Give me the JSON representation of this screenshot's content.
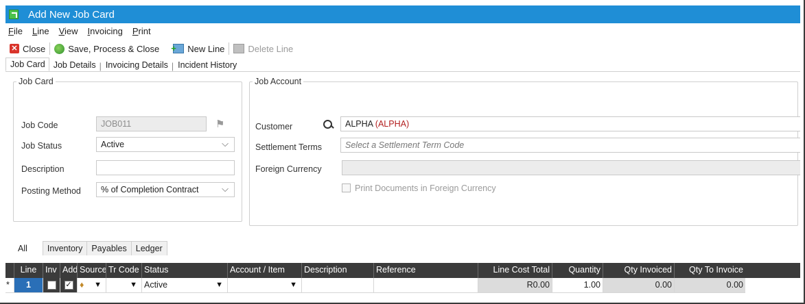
{
  "window": {
    "title": "Add New Job Card"
  },
  "menu": [
    "File",
    "Line",
    "View",
    "Invoicing",
    "Print"
  ],
  "menu_underlines": [
    "F",
    "L",
    "V",
    "I",
    "P"
  ],
  "toolbar": {
    "close": "Close",
    "save_process_close": "Save, Process & Close",
    "new_line": "New Line",
    "delete_line": "Delete Line"
  },
  "tabs": [
    "Job Card",
    "Job Details",
    "Invoicing Details",
    "Incident History"
  ],
  "job_card": {
    "legend": "Job Card",
    "job_code_label": "Job Code",
    "job_code_value": "JOB011",
    "job_status_label": "Job Status",
    "job_status_value": "Active",
    "description_label": "Description",
    "description_value": "",
    "posting_method_label": "Posting Method",
    "posting_method_value": "% of Completion Contract"
  },
  "job_account": {
    "legend": "Job Account",
    "customer_label": "Customer",
    "customer_code": "ALPHA",
    "customer_paren": "(ALPHA)",
    "settlement_terms_label": "Settlement Terms",
    "settlement_terms_placeholder": "Select a Settlement Term Code",
    "foreign_currency_label": "Foreign Currency",
    "foreign_currency_value": "",
    "print_foreign_label": "Print Documents in Foreign Currency"
  },
  "line_tabs": [
    "All",
    "Inventory",
    "Payables",
    "Ledger"
  ],
  "grid": {
    "columns": [
      "Line",
      "Inv",
      "Add",
      "Source",
      "Tr Code",
      "Status",
      "Account / Item",
      "Description",
      "Reference",
      "Line Cost Total",
      "Quantity",
      "Qty Invoiced",
      "Qty To Invoice"
    ],
    "row": {
      "marker": "*",
      "line": "1",
      "inv_checked": false,
      "add_checked": true,
      "status": "Active",
      "line_cost_total": "R0.00",
      "quantity": "1.00",
      "qty_invoiced": "0.00",
      "qty_to_invoice": "0.00"
    }
  }
}
